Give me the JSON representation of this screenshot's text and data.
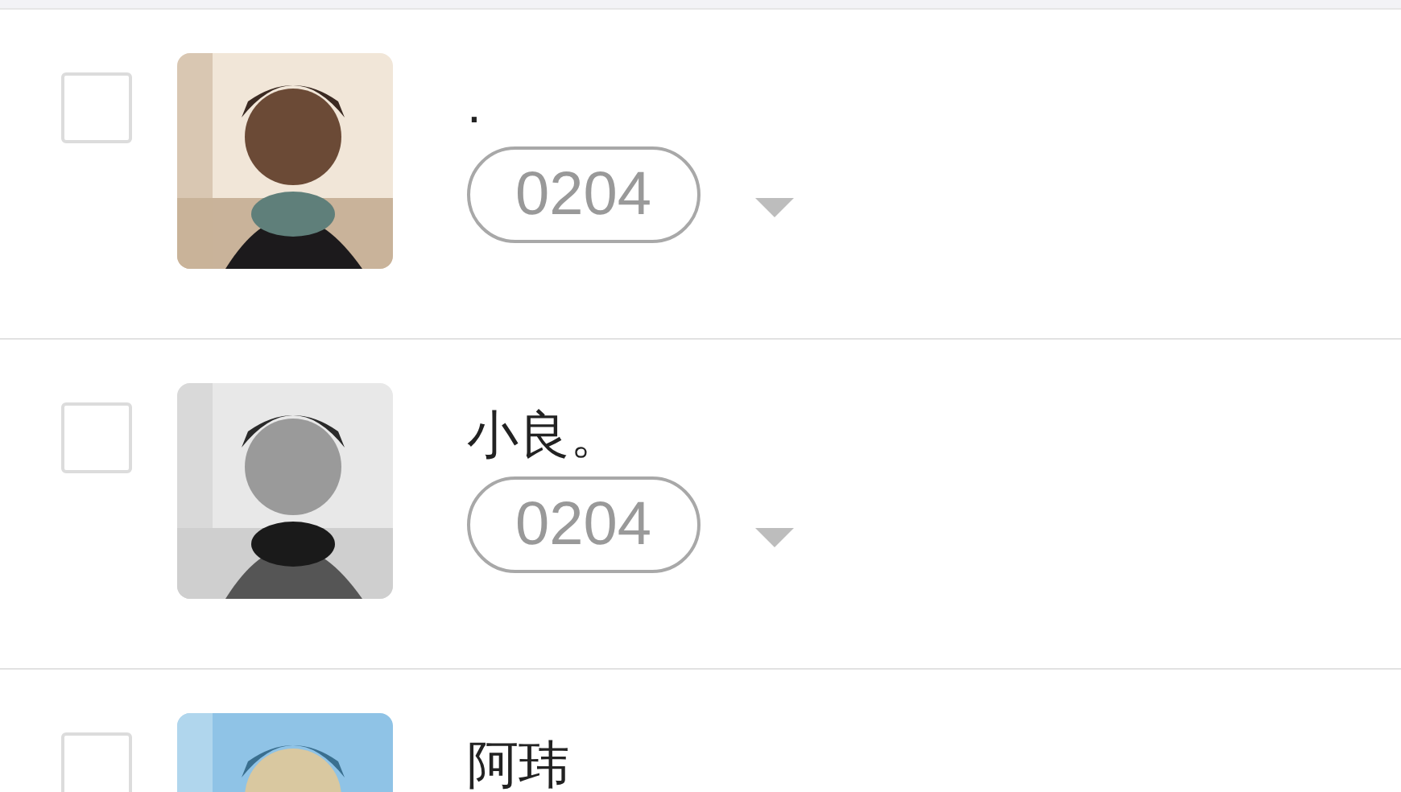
{
  "contacts": [
    {
      "checked": false,
      "name": ".",
      "tag": "0204"
    },
    {
      "checked": false,
      "name": "小良。",
      "tag": "0204"
    },
    {
      "checked": false,
      "name": "阿玮"
    }
  ]
}
